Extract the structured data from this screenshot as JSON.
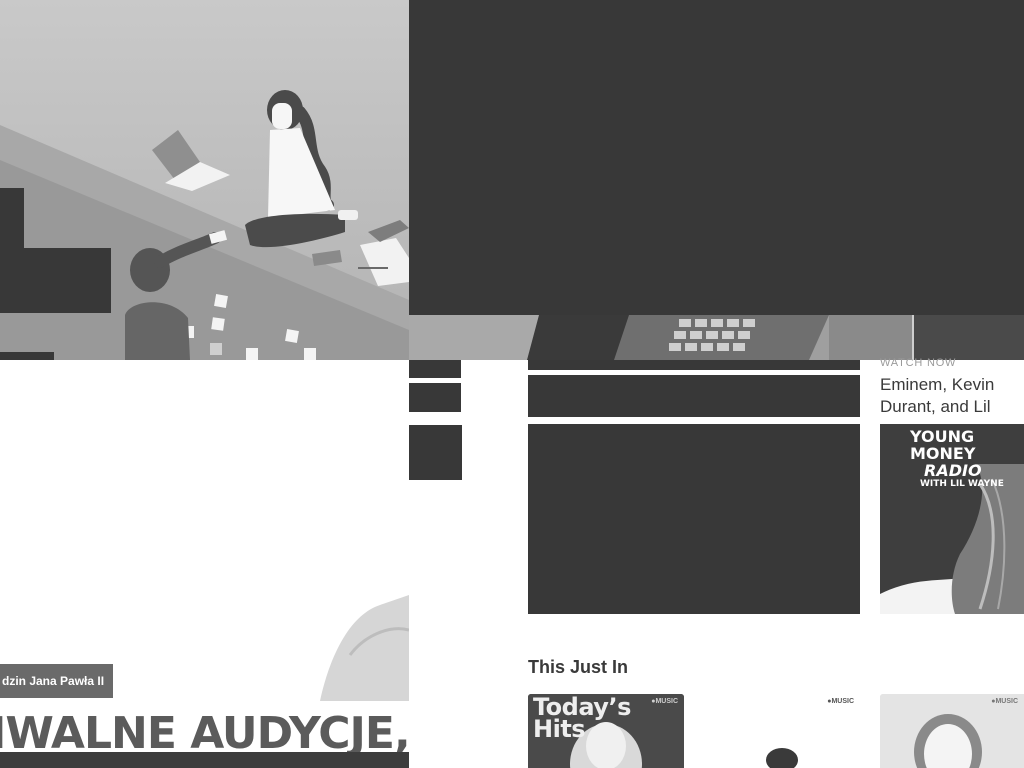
{
  "hero": {
    "kicker": "WATCH NOW",
    "title": "Eminem, Kevin Durant, and Lil Wayne’s livestream"
  },
  "radio_card": {
    "line1": "YOUNG MONEY",
    "line2": "RADIO",
    "line3": "WITH LIL WAYNE"
  },
  "section": {
    "title": "This Just In"
  },
  "tiles": [
    {
      "title": "Today’s Hits",
      "brand": "MUSIC"
    },
    {
      "title": "",
      "brand": "MUSIC"
    },
    {
      "title": "",
      "brand": "MUSIC"
    }
  ],
  "promo": {
    "badge": "dzin Jana Pawła II",
    "headline": "IWALNE AUDYCJE, R"
  },
  "colors": {
    "dark_panel": "#383838",
    "page_bg": "#ffffff",
    "muted_text": "#9a9a9a",
    "heading_text": "#3a3a3a"
  },
  "icons": [
    "apple-music-logo-icon"
  ]
}
